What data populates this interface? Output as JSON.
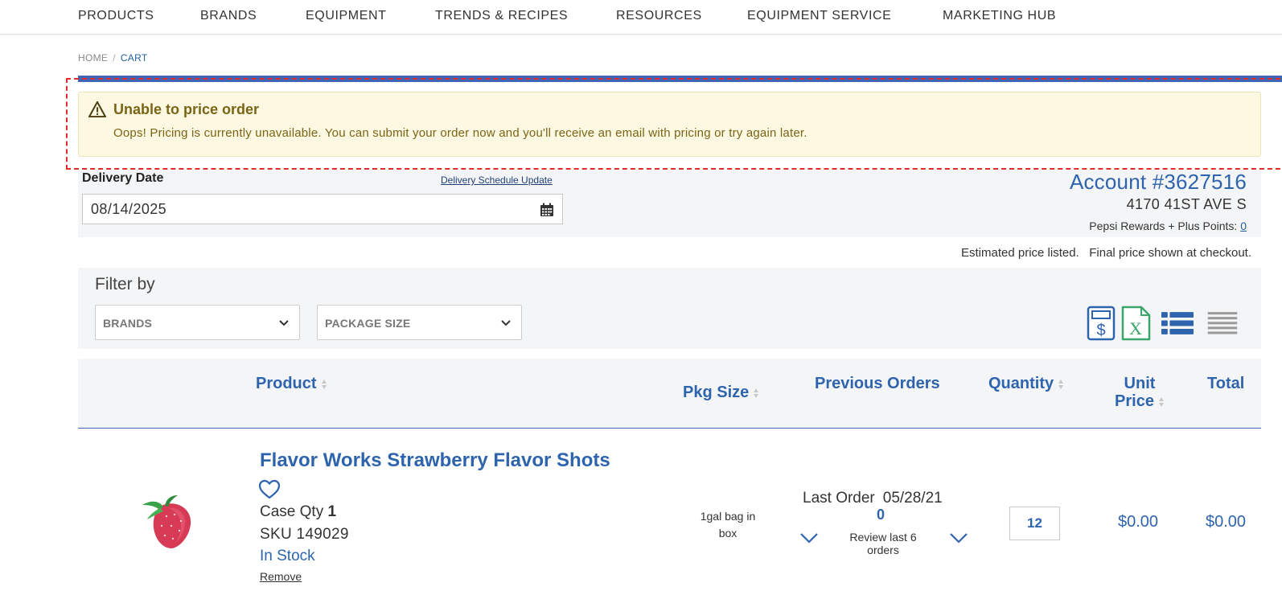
{
  "nav": {
    "items": [
      "PRODUCTS",
      "BRANDS",
      "EQUIPMENT",
      "TRENDS & RECIPES",
      "RESOURCES",
      "EQUIPMENT SERVICE",
      "MARKETING HUB"
    ]
  },
  "breadcrumb": {
    "home": "HOME",
    "separator": "/",
    "current": "CART"
  },
  "alert": {
    "title": "Unable to price order",
    "message": "Oops! Pricing is currently unavailable. You can submit your order now and you'll receive an email with pricing or try again later.",
    "icon": "warning-icon"
  },
  "delivery": {
    "label": "Delivery Date",
    "schedule_link": "Delivery Schedule Update",
    "date_value": "08/14/2025"
  },
  "account": {
    "number": "Account #3627516",
    "address": "4170 41ST AVE S",
    "points_label": "Pepsi Rewards + Plus Points:",
    "points_value": "0"
  },
  "estimate_note": "Estimated price listed.   Final price shown at checkout.",
  "filter": {
    "label": "Filter by",
    "brands": "BRANDS",
    "package_size": "PACKAGE SIZE"
  },
  "table": {
    "headers": {
      "product": "Product",
      "pkg_size": "Pkg Size",
      "previous_orders": "Previous Orders",
      "quantity": "Quantity",
      "unit_price_1": "Unit",
      "unit_price_2": "Price",
      "total": "Total"
    },
    "rows": [
      {
        "name": "Flavor Works Strawberry Flavor Shots",
        "case_qty_label": "Case Qty",
        "case_qty": "1",
        "sku": "SKU 149029",
        "stock": "In Stock",
        "remove": "Remove",
        "pkg_line1": "1gal bag in",
        "pkg_line2": "box",
        "last_order_label": "Last Order",
        "last_order_date": "05/28/21",
        "previous_count": "0",
        "review_line1": "Review last 6",
        "review_line2": "orders",
        "quantity": "12",
        "unit_price": "$0.00",
        "total": "$0.00"
      }
    ]
  },
  "colors": {
    "brand_blue": "#2e64ae",
    "alert_bg": "#fcf8e2",
    "alert_text": "#7a6416",
    "highlight_dash": "#e02b2b"
  }
}
